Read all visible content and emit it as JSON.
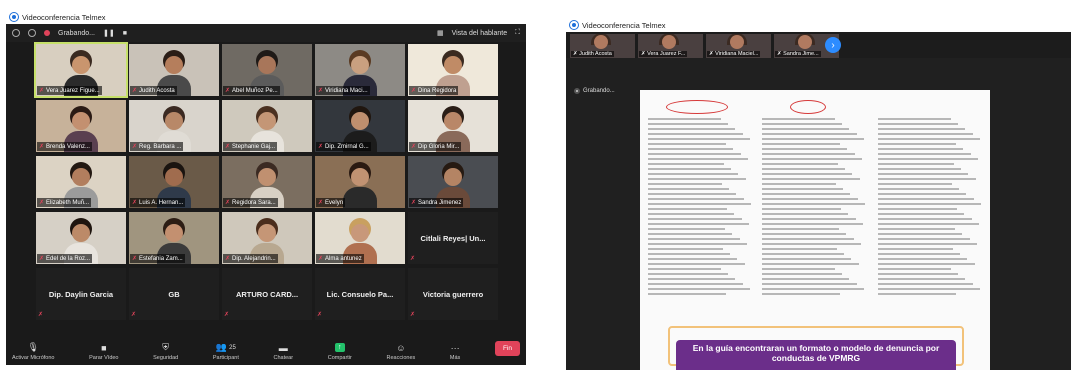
{
  "window1": {
    "title": "Videoconferencia Telmex",
    "recording_label": "Grabando...",
    "view_label": "Vista del hablante",
    "tiles": [
      {
        "name": "Vera Juarez Figue...",
        "active": true,
        "bg": "#d8cfc0",
        "skin": "#c9956e",
        "hair": "#3a2a20",
        "shirt": "#2b2b2b"
      },
      {
        "name": "Judith Acosta",
        "bg": "#c9c2b8",
        "skin": "#b57e5c",
        "hair": "#2a1d16",
        "shirt": "#4a4a4a"
      },
      {
        "name": "Abel Muñoz Pe...",
        "bg": "#6f6a63",
        "skin": "#a8765a",
        "hair": "#1f1a17",
        "shirt": "#5b5b5b"
      },
      {
        "name": "Viridiana Maci...",
        "bg": "#8d8a85",
        "skin": "#c9a080",
        "hair": "#5a3a22",
        "shirt": "#2a2a3a"
      },
      {
        "name": "Dina Regidora",
        "bg": "#efe8da",
        "skin": "#c08b66",
        "hair": "#3a2a20",
        "shirt": "#bfa090"
      },
      {
        "name": "Brenda Valenz...",
        "bg": "#c7b29a",
        "skin": "#c39070",
        "hair": "#2a1a14",
        "shirt": "#5a4050"
      },
      {
        "name": "Reg. Barbara ...",
        "bg": "#d9d4cc",
        "skin": "#b88868",
        "hair": "#3b2a22",
        "shirt": "#e0dcd5"
      },
      {
        "name": "Stephanie Gaj...",
        "bg": "#cfc9bd",
        "skin": "#c49676",
        "hair": "#4a3020",
        "shirt": "#e7e3dc"
      },
      {
        "name": "Dip. Zmirnal G...",
        "bg": "#33373d",
        "skin": "#bf8f6e",
        "hair": "#20160f",
        "shirt": "#1c1c1c"
      },
      {
        "name": "Dip Gloria Mir...",
        "bg": "#e6e1d8",
        "skin": "#b98768",
        "hair": "#2a1d16",
        "shirt": "#8a6a5a"
      },
      {
        "name": "Elizabeth Muñ...",
        "bg": "#dcd3c4",
        "skin": "#b27e5e",
        "hair": "#231812",
        "shirt": "#9b9b9b"
      },
      {
        "name": "Luis A. Hernan...",
        "bg": "#6a5a48",
        "skin": "#a06c4e",
        "hair": "#1a1410",
        "shirt": "#2f3a4a"
      },
      {
        "name": "Regidora Sara...",
        "bg": "#7b6e60",
        "skin": "#c09070",
        "hair": "#3b2a22",
        "shirt": "#d8d0c4"
      },
      {
        "name": "Evelyn",
        "bg": "#8a6f55",
        "skin": "#c19272",
        "hair": "#2a1a12",
        "shirt": "#2a2a2a"
      },
      {
        "name": "Sandra Jimenez",
        "bg": "#4a4d52",
        "skin": "#b48464",
        "hair": "#261a12",
        "shirt": "#6a4a3a"
      },
      {
        "name": "Edel de la Roz...",
        "bg": "#d6d0c6",
        "skin": "#bc8a68",
        "hair": "#1f150f",
        "shirt": "#e8e4de"
      },
      {
        "name": "Estefania Zam...",
        "bg": "#a0957f",
        "skin": "#c39070",
        "hair": "#2c1d14",
        "shirt": "#3b3b3b"
      },
      {
        "name": "Dip. Alejandrin...",
        "bg": "#cfc8bb",
        "skin": "#c59676",
        "hair": "#4a2d1c",
        "shirt": "#b8a890"
      },
      {
        "name": "Alma antunez",
        "bg": "#e2dccf",
        "skin": "#c8987a",
        "hair": "#c9a060",
        "shirt": "#b07050"
      },
      {
        "name": "Citlali Reyes| Un...",
        "textonly": true
      },
      {
        "name": "Dip. Daylin Garcia",
        "textonly": true
      },
      {
        "name": "GB",
        "textonly": true
      },
      {
        "name": "ARTURO CARD...",
        "textonly": true
      },
      {
        "name": "Lic. Consuelo Pa...",
        "textonly": true
      },
      {
        "name": "Victoria guerrero",
        "textonly": true
      }
    ],
    "toolbar": [
      {
        "icon": "mic-off-icon",
        "glyph": "🎙",
        "label": "Activar Micrófono"
      },
      {
        "icon": "video-icon",
        "glyph": "■",
        "label": "Parar Vídeo"
      },
      {
        "icon": "shield-icon",
        "glyph": "⛨",
        "label": "Seguridad"
      },
      {
        "icon": "participants-icon",
        "glyph": "👥",
        "label": "Participant",
        "badge": "25"
      },
      {
        "icon": "chat-icon",
        "glyph": "▬",
        "label": "Chatear"
      },
      {
        "icon": "share-icon",
        "glyph": "↑",
        "label": "Compartir",
        "green": true
      },
      {
        "icon": "reactions-icon",
        "glyph": "☺",
        "label": "Reacciones"
      },
      {
        "icon": "more-icon",
        "glyph": "···",
        "label": "Más"
      }
    ],
    "end_label": "Fin"
  },
  "window2": {
    "title": "Videoconferencia Telmex",
    "recording_label": "Grabando...",
    "strip": [
      {
        "name": "Judith Acosta"
      },
      {
        "name": "Vera Juarez F..."
      },
      {
        "name": "Viridiana Maciel..."
      },
      {
        "name": "Sandra Jime..."
      }
    ],
    "banner_text": "En la guía encontraran un formato o modelo de denuncia por conductas de VPMRG",
    "accent": "#2d8cff",
    "record_color": "#e0435a",
    "banner_color": "#6b2e8a"
  }
}
